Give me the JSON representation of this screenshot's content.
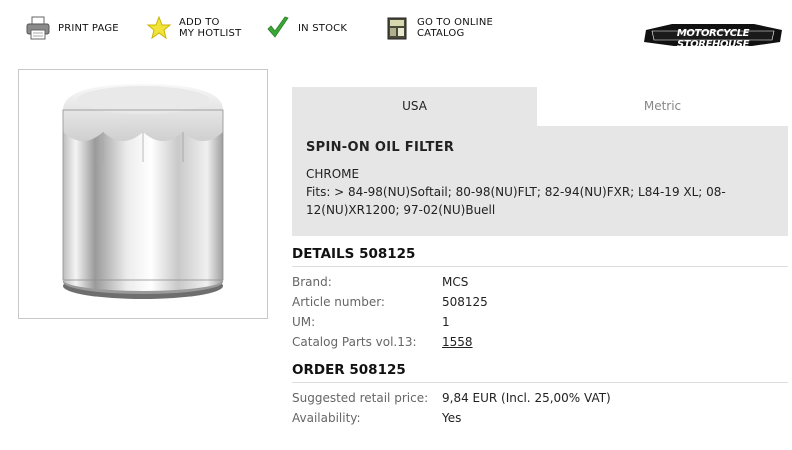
{
  "toolbar": {
    "print": {
      "line1": "PRINT PAGE",
      "icon": "printer-icon"
    },
    "hotlist": {
      "line1": "ADD TO",
      "line2": "MY HOTLIST",
      "icon": "star-icon"
    },
    "stock": {
      "line1": "IN STOCK",
      "icon": "checkmark-icon"
    },
    "catalog": {
      "line1": "GO TO ONLINE",
      "line2": "CATALOG",
      "icon": "catalog-icon"
    }
  },
  "brand_logo": {
    "text": "MOTORCYCLE STOREHOUSE"
  },
  "product_image": {
    "icon": "chrome-oil-filter-image"
  },
  "tabs": [
    {
      "label": "USA",
      "active": true
    },
    {
      "label": "Metric",
      "active": false
    }
  ],
  "description": {
    "title": "SPIN-ON OIL FILTER",
    "variant": "CHROME",
    "fits_line1": "Fits: > 84-98(NU)Softail; 80-98(NU)FLT; 82-94(NU)FXR; L84-19 XL; 08-",
    "fits_line2": "12(NU)XR1200; 97-02(NU)Buell"
  },
  "details": {
    "heading": "DETAILS 508125",
    "rows": [
      {
        "label": "Brand:",
        "value": "MCS"
      },
      {
        "label": "Article number:",
        "value": "508125"
      },
      {
        "label": "UM:",
        "value": "1"
      },
      {
        "label": "Catalog Parts vol.13:",
        "value": "1558"
      }
    ]
  },
  "order": {
    "heading": "ORDER 508125",
    "rows": [
      {
        "label": "Suggested retail price:",
        "value": "9,84 EUR (Incl. 25,00% VAT)"
      },
      {
        "label": "Availability:",
        "value": "Yes"
      }
    ]
  },
  "colors": {
    "panel": "#e6e6e6",
    "stock_green": "#3aa835",
    "star_yellow": "#f2e33a"
  }
}
